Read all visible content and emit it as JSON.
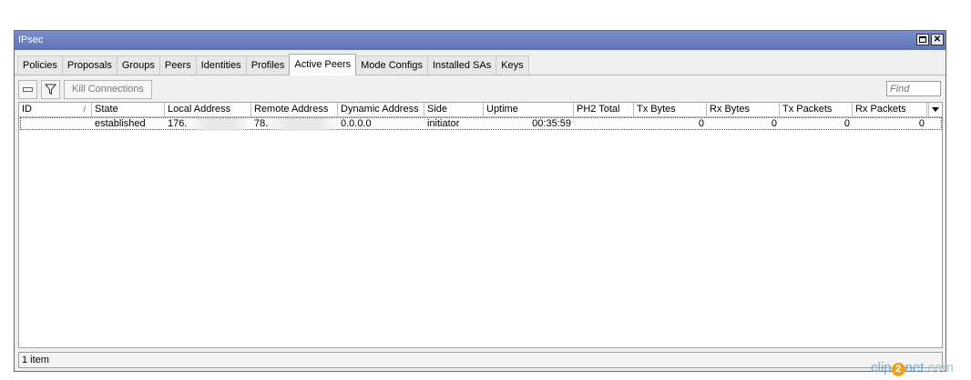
{
  "window": {
    "title": "IPsec"
  },
  "tabs": [
    {
      "label": "Policies"
    },
    {
      "label": "Proposals"
    },
    {
      "label": "Groups"
    },
    {
      "label": "Peers"
    },
    {
      "label": "Identities"
    },
    {
      "label": "Profiles"
    },
    {
      "label": "Active Peers",
      "active": true
    },
    {
      "label": "Mode Configs"
    },
    {
      "label": "Installed SAs"
    },
    {
      "label": "Keys"
    }
  ],
  "toolbar": {
    "kill_label": "Kill Connections",
    "find_placeholder": "Find"
  },
  "columns": [
    "ID",
    "State",
    "Local Address",
    "Remote Address",
    "Dynamic Address",
    "Side",
    "Uptime",
    "PH2 Total",
    "Tx Bytes",
    "Rx Bytes",
    "Tx Packets",
    "Rx Packets"
  ],
  "sort_indicator": "/",
  "rows": [
    {
      "id": "",
      "state": "established",
      "local_address": "176.",
      "remote_address": "78.",
      "dynamic_address": "0.0.0.0",
      "side": "initiator",
      "uptime": "00:35:59",
      "ph2_total": "",
      "tx_bytes": "0",
      "rx_bytes": "0",
      "tx_packets": "0",
      "rx_packets": "0"
    }
  ],
  "status": {
    "count": "1 item"
  },
  "watermark": {
    "pre": "clip",
    "num": "2",
    "post": "net",
    "suffix": ".com"
  },
  "colors": {
    "titlebar": "#6a7fc0",
    "accent": "#f0a020"
  }
}
